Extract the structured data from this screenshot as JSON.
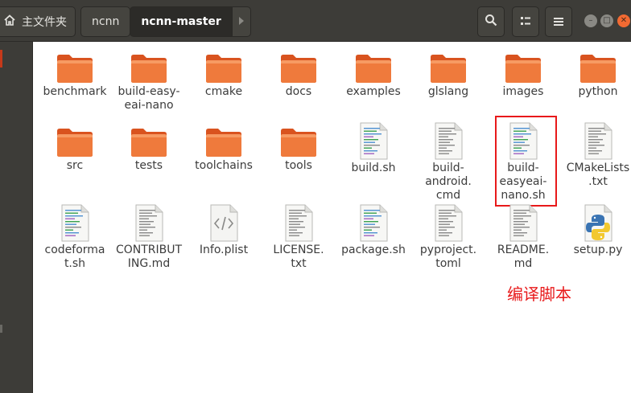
{
  "breadcrumb": {
    "home": "主文件夹",
    "items": [
      "ncnn",
      "ncnn-master"
    ]
  },
  "toolbar": {
    "search": "search-icon",
    "view": "list-view-icon",
    "menu": "hamburger-menu-icon"
  },
  "window_controls": [
    "minimize",
    "maximize",
    "close"
  ],
  "colors": {
    "header": "#3d3c38",
    "folder": "#e8662f",
    "highlight": "#e8191a"
  },
  "files": [
    {
      "name": "benchmark",
      "type": "folder"
    },
    {
      "name": "build-easy-\neai-nano",
      "type": "folder"
    },
    {
      "name": "cmake",
      "type": "folder"
    },
    {
      "name": "docs",
      "type": "folder"
    },
    {
      "name": "examples",
      "type": "folder"
    },
    {
      "name": "glslang",
      "type": "folder"
    },
    {
      "name": "images",
      "type": "folder"
    },
    {
      "name": "python",
      "type": "folder"
    },
    {
      "name": "src",
      "type": "folder"
    },
    {
      "name": "tests",
      "type": "folder"
    },
    {
      "name": "toolchains",
      "type": "folder"
    },
    {
      "name": "tools",
      "type": "folder"
    },
    {
      "name": "build.sh",
      "type": "script"
    },
    {
      "name": "build-\nandroid.\ncmd",
      "type": "text"
    },
    {
      "name": "build-\neasyeai-\nnano.sh",
      "type": "script"
    },
    {
      "name": "CMakeLists\n.txt",
      "type": "text"
    },
    {
      "name": "codeforma\nt.sh",
      "type": "script"
    },
    {
      "name": "CONTRIBUT\nING.md",
      "type": "text"
    },
    {
      "name": "Info.plist",
      "type": "xml"
    },
    {
      "name": "LICENSE.\ntxt",
      "type": "text"
    },
    {
      "name": "package.sh",
      "type": "script"
    },
    {
      "name": "pyproject.\ntoml",
      "type": "text"
    },
    {
      "name": "README.\nmd",
      "type": "text"
    },
    {
      "name": "setup.py",
      "type": "python"
    }
  ],
  "annotation": "编译脚本"
}
